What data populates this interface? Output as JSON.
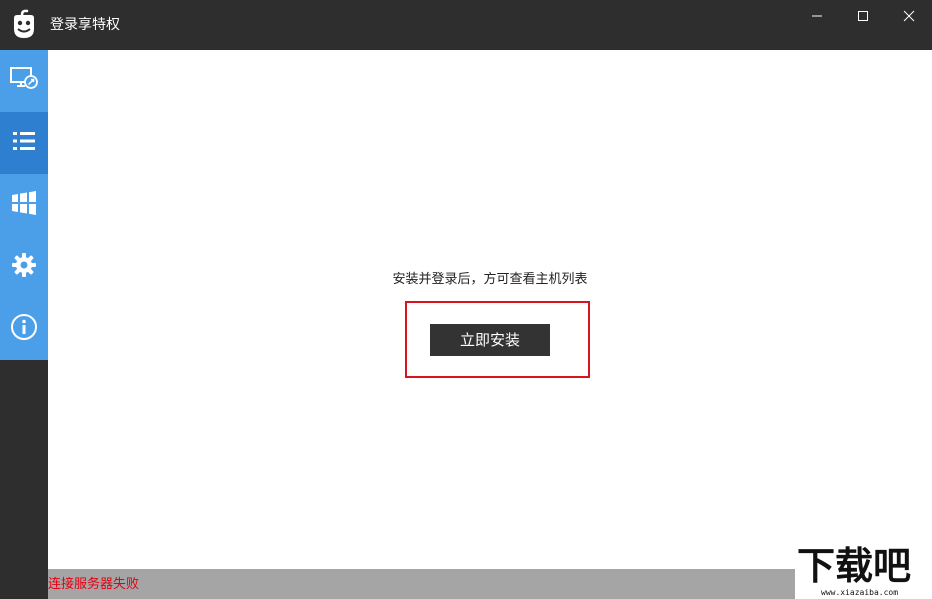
{
  "window": {
    "title": "登录享特权",
    "logo_icon": "app-logo-icon",
    "controls": {
      "minimize_icon": "minimize-icon",
      "maximize_icon": "maximize-icon",
      "close_icon": "close-icon"
    }
  },
  "sidebar": {
    "items": [
      {
        "icon": "remote-desktop-icon",
        "active": false
      },
      {
        "icon": "list-icon",
        "active": true
      },
      {
        "icon": "windows-icon",
        "active": false
      },
      {
        "icon": "gear-icon",
        "active": false
      },
      {
        "icon": "info-icon",
        "active": false
      }
    ]
  },
  "main": {
    "hint": "安装并登录后，方可查看主机列表",
    "install_button": "立即安装"
  },
  "status": {
    "message": "连接服务器失败"
  },
  "watermark": {
    "main": "下载吧",
    "sub": "www.xiazaiba.com"
  },
  "colors": {
    "titlebar": "#2e2e2e",
    "sidebar_item": "#4a9fe8",
    "sidebar_active": "#2f7fd0",
    "button": "#333333",
    "highlight_border": "#d9141e",
    "status_bar": "#a5a5a5",
    "status_error": "#e60012"
  }
}
